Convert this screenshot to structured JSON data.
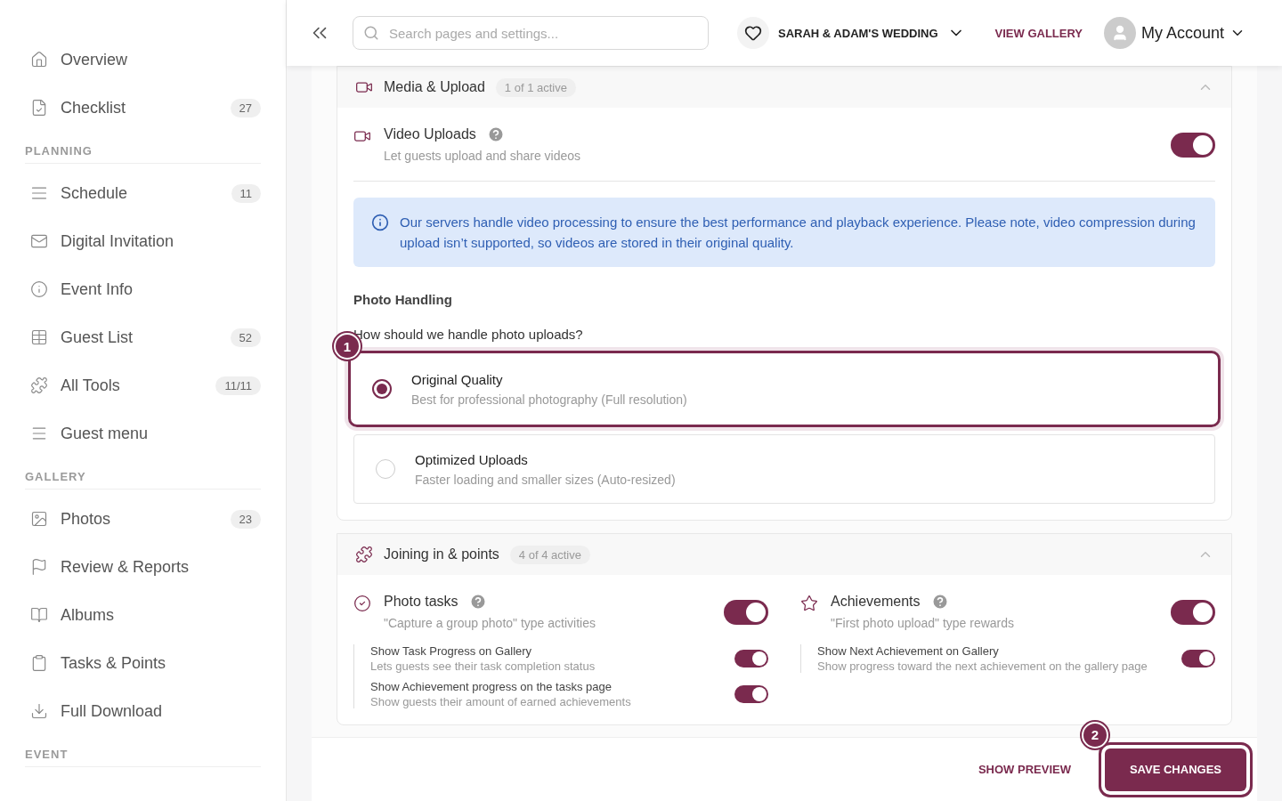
{
  "sidebar": {
    "sections": [
      {
        "items": [
          {
            "label": "Overview"
          },
          {
            "label": "Checklist",
            "count": "27"
          }
        ]
      },
      {
        "title": "PLANNING",
        "items": [
          {
            "label": "Schedule",
            "count": "11"
          },
          {
            "label": "Digital Invitation"
          },
          {
            "label": "Event Info"
          },
          {
            "label": "Guest List",
            "count": "52"
          },
          {
            "label": "All Tools",
            "count": "11/11"
          },
          {
            "label": "Guest menu"
          }
        ]
      },
      {
        "title": "GALLERY",
        "items": [
          {
            "label": "Photos",
            "count": "23"
          },
          {
            "label": "Review & Reports"
          },
          {
            "label": "Albums"
          },
          {
            "label": "Tasks & Points"
          },
          {
            "label": "Full Download"
          }
        ]
      },
      {
        "title": "EVENT"
      }
    ]
  },
  "header": {
    "search": {
      "placeholder": "Search pages and settings..."
    },
    "event": "SARAH & ADAM'S WEDDING",
    "view_gallery": "VIEW GALLERY",
    "account": "My Account"
  },
  "media_section": {
    "title": "Media & Upload",
    "badge": "1 of 1 active",
    "expanded": true,
    "feature": {
      "title": "Video Uploads",
      "description": "Let guests upload and share videos",
      "on": true
    },
    "info": "Our servers handle video processing to ensure the best performance and playback experience. Please note, video compression during upload isn’t supported, so videos are stored in their original quality.",
    "photo_heading": "Photo Handling",
    "question": "How should we handle photo uploads?",
    "options": [
      {
        "title": "Original Quality",
        "description": "Best for professional photography (Full resolution)",
        "selected": true,
        "marker": "1"
      },
      {
        "title": "Optimized Uploads",
        "description": "Faster loading and smaller sizes (Auto-resized)",
        "selected": false
      }
    ]
  },
  "joining_section": {
    "title": "Joining in & points",
    "badge": "4 of 4 active",
    "expanded": true,
    "features": [
      {
        "title": "Photo tasks",
        "description": "\"Capture a group photo\" type activities",
        "on": true,
        "subs": [
          {
            "title": "Show Task Progress on Gallery",
            "description": "Lets guests see their task completion status",
            "on": true
          },
          {
            "title": "Show Achievement progress on the tasks page",
            "description": "Show guests their amount of earned achievements",
            "on": true
          }
        ]
      },
      {
        "title": "Achievements",
        "description": "\"First photo upload\" type rewards",
        "on": true,
        "subs": [
          {
            "title": "Show Next Achievement on Gallery",
            "description": "Show progress toward the next achievement on the gallery page",
            "on": true
          }
        ]
      }
    ]
  },
  "footer": {
    "preview": "SHOW PREVIEW",
    "save": "SAVE CHANGES",
    "save_marker": "2"
  }
}
